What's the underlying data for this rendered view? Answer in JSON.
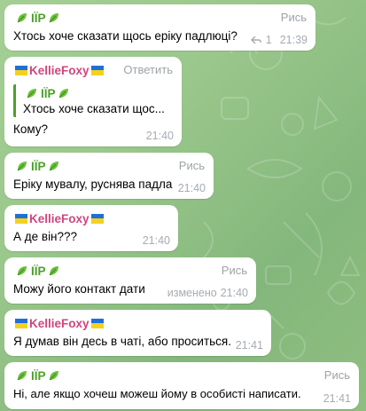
{
  "messages": [
    {
      "author": "ІЇР",
      "role": "Рись",
      "text": "Хтось хоче сказати щось еріку падлюці?",
      "replies": "1",
      "time": "21:39"
    },
    {
      "author": "KellieFoxy",
      "role": "Ответить",
      "quote_author": "ІЇР",
      "quote_text": "Хтось хоче сказати щос...",
      "text": "Кому?",
      "time": "21:40"
    },
    {
      "author": "ІЇР",
      "role": "Рись",
      "text": "Еріку мувалу, руснява падла",
      "time": "21:40"
    },
    {
      "author": "KellieFoxy",
      "text": "А де він???",
      "time": "21:40"
    },
    {
      "author": "ІЇР",
      "role": "Рись",
      "text": "Можу його контакт дати",
      "edited": "изменено",
      "time": "21:40"
    },
    {
      "author": "KellieFoxy",
      "text": "Я думав він десь в чаті, або проситься.",
      "time": "21:41"
    },
    {
      "author": "ІЇР",
      "role": "Рись",
      "text": "Ні, але якщо хочеш можеш йому в особисті написати.",
      "time": "21:41"
    }
  ],
  "colors": {
    "iip_name": "#4ca02a",
    "kellie_name": "#d0457e",
    "meta": "#a5acb2"
  },
  "icons": [
    "leaf-emoji-icon",
    "ukraine-flag-icon",
    "reply-arrow-icon"
  ]
}
